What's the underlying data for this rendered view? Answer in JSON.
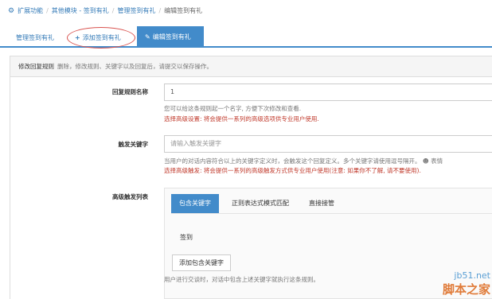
{
  "breadcrumb": {
    "items": [
      "扩展功能",
      "其他模块 - 签到有礼",
      "管理签到有礼",
      "编辑签到有礼"
    ]
  },
  "tabs": {
    "manage": "管理签到有礼",
    "add": "添加签到有礼",
    "edit": "编辑签到有礼"
  },
  "panel": {
    "heading": "修改回复规则",
    "note": "删除，修改规则、关键字以及回复后，请提交以保存操作。"
  },
  "rule_name": {
    "label": "回复规则名称",
    "value": "1",
    "help": "您可以给这条规则起一个名字, 方便下次修改和查看.",
    "warning": "选择高级设置: 将会提供一系列的高级选项供专业用户使用."
  },
  "trigger_keyword": {
    "label": "触发关键字",
    "placeholder": "请输入触发关键字",
    "help": "当用户的对话内容符合以上的关键字定义时，会触发这个回复定义。多个关键字请使用逗号隔开。",
    "help_extra": "表情",
    "warning": "选择高级触发: 将会提供一系列的高级触发方式供专业用户使用(注意: 如果你不了解, 请不要使用)."
  },
  "advanced_triggers": {
    "label": "高级触发列表",
    "tabs": [
      "包含关键字",
      "正则表达式模式匹配",
      "直接接管"
    ],
    "keyword": "签到",
    "add_button": "添加包含关键字",
    "help": "用户进行交谈时，对话中包含上述关键字就执行这条规则。"
  },
  "watermark": {
    "top": "jb51.net",
    "bottom": "脚本之家"
  },
  "colors": {
    "primary": "#428bca",
    "link": "#337ab7",
    "warning": "#c0392b",
    "annotation": "#d9534f"
  }
}
